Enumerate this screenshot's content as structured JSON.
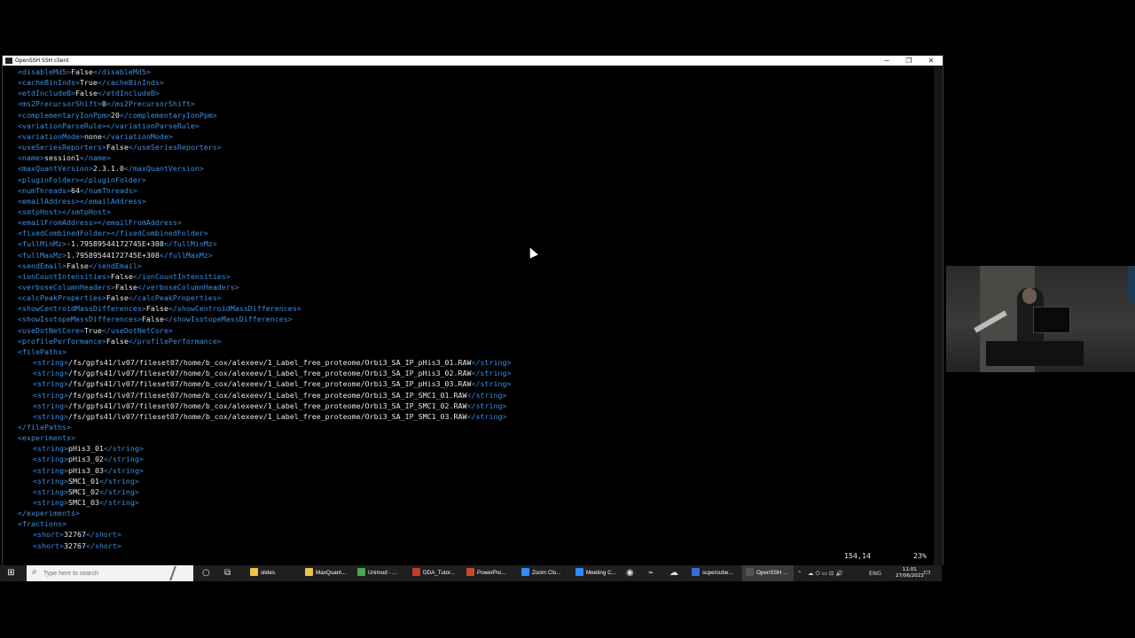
{
  "window": {
    "title": "OpenSSH SSH client",
    "minimize": "─",
    "restore": "❐",
    "close": "✕"
  },
  "terminal": {
    "lines": [
      {
        "indent": 0,
        "open": "<disableMd5>",
        "value": "False",
        "close": "</disableMd5>"
      },
      {
        "indent": 0,
        "open": "<cacheBinInds>",
        "value": "True",
        "close": "</cacheBinInds>"
      },
      {
        "indent": 0,
        "open": "<etdIncludeB>",
        "value": "False",
        "close": "</etdIncludeB>"
      },
      {
        "indent": 0,
        "open": "<ms2PrecursorShift>",
        "value": "0",
        "close": "</ms2PrecursorShift>"
      },
      {
        "indent": 0,
        "open": "<complementaryIonPpm>",
        "value": "20",
        "close": "</complementaryIonPpm>"
      },
      {
        "indent": 0,
        "open": "<variationParseRule>",
        "value": "",
        "close": "</variationParseRule>"
      },
      {
        "indent": 0,
        "open": "<variationMode>",
        "value": "none",
        "close": "</variationMode>"
      },
      {
        "indent": 0,
        "open": "<useSeriesReporters>",
        "value": "False",
        "close": "</useSeriesReporters>"
      },
      {
        "indent": 0,
        "open": "<name>",
        "value": "session1",
        "close": "</name>"
      },
      {
        "indent": 0,
        "open": "<maxQuantVersion>",
        "value": "2.3.1.0",
        "close": "</maxQuantVersion>"
      },
      {
        "indent": 0,
        "open": "<pluginFolder>",
        "value": "",
        "close": "</pluginFolder>"
      },
      {
        "indent": 0,
        "open": "<numThreads>",
        "value": "64",
        "close": "</numThreads>"
      },
      {
        "indent": 0,
        "open": "<emailAddress>",
        "value": "",
        "close": "</emailAddress>"
      },
      {
        "indent": 0,
        "open": "<smtpHost>",
        "value": "",
        "close": "</smtpHost>"
      },
      {
        "indent": 0,
        "open": "<emailFromAddress>",
        "value": "",
        "close": "</emailFromAddress>"
      },
      {
        "indent": 0,
        "open": "<fixedCombinedFolder>",
        "value": "",
        "close": "</fixedCombinedFolder>"
      },
      {
        "indent": 0,
        "open": "<fullMinMz>",
        "value": "-1.79589544172745E+308",
        "close": "</fullMinMz>"
      },
      {
        "indent": 0,
        "open": "<fullMaxMz>",
        "value": "1.79589544172745E+308",
        "close": "</fullMaxMz>"
      },
      {
        "indent": 0,
        "open": "<sendEmail>",
        "value": "False",
        "close": "</sendEmail>"
      },
      {
        "indent": 0,
        "open": "<ionCountIntensities>",
        "value": "False",
        "close": "</ionCountIntensities>"
      },
      {
        "indent": 0,
        "open": "<verboseColumnHeaders>",
        "value": "False",
        "close": "</verboseColumnHeaders>"
      },
      {
        "indent": 0,
        "open": "<calcPeakProperties>",
        "value": "False",
        "close": "</calcPeakProperties>"
      },
      {
        "indent": 0,
        "open": "<showCentroidMassDifferences>",
        "value": "False",
        "close": "</showCentroidMassDifferences>"
      },
      {
        "indent": 0,
        "open": "<showIsotopeMassDifferences>",
        "value": "False",
        "close": "</showIsotopeMassDifferences>"
      },
      {
        "indent": 0,
        "open": "<useDotNetCore>",
        "value": "True",
        "close": "</useDotNetCore>"
      },
      {
        "indent": 0,
        "open": "<profilePerformance>",
        "value": "False",
        "close": "</profilePerformance>"
      },
      {
        "indent": 0,
        "open": "<filePaths>",
        "value": "",
        "close": ""
      },
      {
        "indent": 1,
        "open": "<string>",
        "value": "/fs/gpfs41/lv07/fileset07/home/b_cox/alexeev/1_Label_free_proteome/Orbi3_SA_IP_pHis3_01.RAW",
        "close": "</string>"
      },
      {
        "indent": 1,
        "open": "<string>",
        "value": "/fs/gpfs41/lv07/fileset07/home/b_cox/alexeev/1_Label_free_proteome/Orbi3_SA_IP_pHis3_02.RAW",
        "close": "</string>"
      },
      {
        "indent": 1,
        "open": "<string>",
        "value": "/fs/gpfs41/lv07/fileset07/home/b_cox/alexeev/1_Label_free_proteome/Orbi3_SA_IP_pHis3_03.RAW",
        "close": "</string>"
      },
      {
        "indent": 1,
        "open": "<string>",
        "value": "/fs/gpfs41/lv07/fileset07/home/b_cox/alexeev/1_Label_free_proteome/Orbi3_SA_IP_SMC1_01.RAW",
        "close": "</string>"
      },
      {
        "indent": 1,
        "open": "<string>",
        "value": "/fs/gpfs41/lv07/fileset07/home/b_cox/alexeev/1_Label_free_proteome/Orbi3_SA_IP_SMC1_02.RAW",
        "close": "</string>"
      },
      {
        "indent": 1,
        "open": "<string>",
        "value": "/fs/gpfs41/lv07/fileset07/home/b_cox/alexeev/1_Label_free_proteome/Orbi3_SA_IP_SMC1_03.RAW",
        "close": "</string>"
      },
      {
        "indent": 0,
        "open": "</filePaths>",
        "value": "",
        "close": ""
      },
      {
        "indent": 0,
        "open": "<experiments>",
        "value": "",
        "close": ""
      },
      {
        "indent": 1,
        "open": "<string>",
        "value": "pHis3_01",
        "close": "</string>"
      },
      {
        "indent": 1,
        "open": "<string>",
        "value": "pHis3_02",
        "close": "</string>"
      },
      {
        "indent": 1,
        "open": "<string>",
        "value": "pHis3_03",
        "close": "</string>"
      },
      {
        "indent": 1,
        "open": "<string>",
        "value": "SMC1_01",
        "close": "</string>"
      },
      {
        "indent": 1,
        "open": "<string>",
        "value": "SMC1_02",
        "close": "</string>"
      },
      {
        "indent": 1,
        "open": "<string>",
        "value": "SMC1_03",
        "close": "</string>"
      },
      {
        "indent": 0,
        "open": "</experiments>",
        "value": "",
        "close": ""
      },
      {
        "indent": 0,
        "open": "<fractions>",
        "value": "",
        "close": ""
      },
      {
        "indent": 1,
        "open": "<short>",
        "value": "32767",
        "close": "</short>"
      },
      {
        "indent": 1,
        "open": "<short>",
        "value": "32767",
        "close": "</short>"
      }
    ],
    "position": "154,14",
    "percent": "23%"
  },
  "colors": {
    "tag": "#3d8ee0",
    "text": "#e6e6e6",
    "background": "#000000"
  },
  "taskbar": {
    "start_icon": "windows-logo-icon",
    "search_placeholder": "Type here to search",
    "apps": [
      {
        "label": "slides",
        "icon_color": "#e8c64a"
      },
      {
        "label": "MaxQuant...",
        "icon_color": "#e8c64a"
      },
      {
        "label": "Unimod - ...",
        "icon_color": "#4aa64a"
      },
      {
        "label": "DDA_Tutor...",
        "icon_color": "#c33b2a"
      },
      {
        "label": "PowerPoi...",
        "icon_color": "#c8492a"
      },
      {
        "label": "Zoom Clo...",
        "icon_color": "#2d8cff"
      },
      {
        "label": "Meeting C...",
        "icon_color": "#2d8cff"
      },
      {
        "label": "supercube...",
        "icon_color": "#3b6fd4"
      },
      {
        "label": "OpenSSH ...",
        "icon_color": "#555555"
      }
    ],
    "language": "ENG",
    "time": "11:01",
    "date": "27/06/2023"
  }
}
